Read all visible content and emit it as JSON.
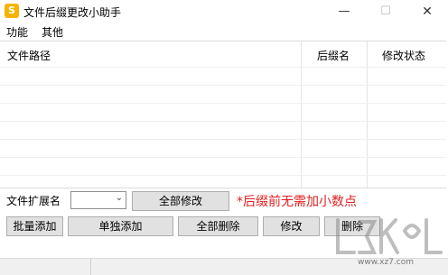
{
  "window": {
    "title": "文件后缀更改小助手",
    "icon_letter": "S",
    "min_glyph": "—",
    "max_glyph": "☐",
    "close_glyph": "✕"
  },
  "menu": {
    "items": [
      "功能",
      "其他"
    ]
  },
  "table": {
    "headers": [
      "文件路径",
      "后缀名",
      "修改状态"
    ]
  },
  "controls": {
    "ext_label": "文件扩展名",
    "ext_value": "",
    "modify_all": "全部修改",
    "hint": "*后缀前无需加小数点",
    "batch_add": "批量添加",
    "single_add": "单独添加",
    "delete_all": "全部删除",
    "modify": "修改",
    "delete": "删除"
  },
  "watermark": {
    "text": "www.xz7.com"
  },
  "colors": {
    "hint_red": "#e02020",
    "icon_yellow": "#f5b400"
  }
}
